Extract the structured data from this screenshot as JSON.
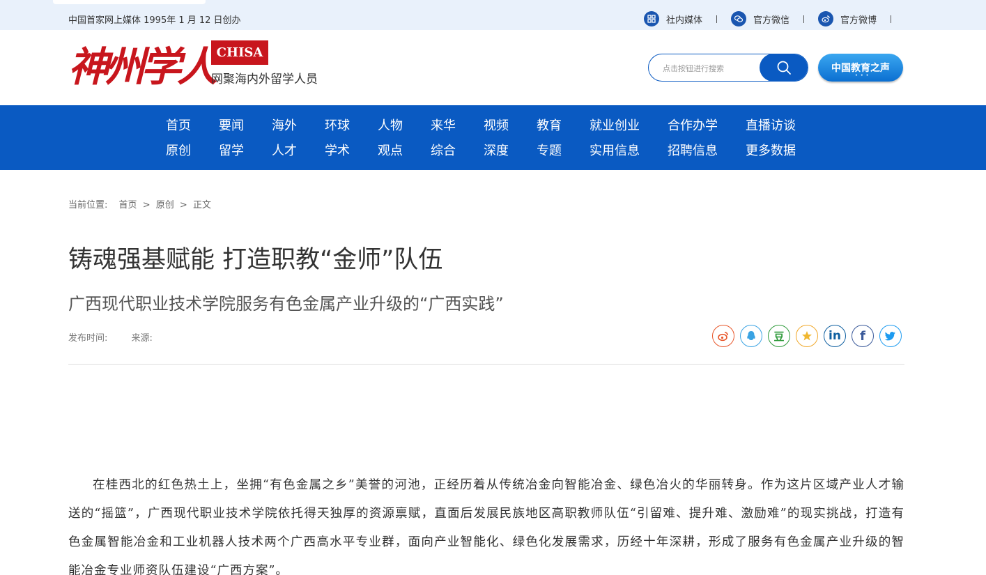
{
  "topbar": {
    "slogan": "中国首家网上媒体 1995年 1 月 12 日创办",
    "links": [
      {
        "label": "社内媒体",
        "icon": "grid-icon"
      },
      {
        "label": "官方微信",
        "icon": "wechat-icon"
      },
      {
        "label": "官方微博",
        "icon": "weibo-icon"
      }
    ]
  },
  "header": {
    "logo_text": "神州学人",
    "logo_badge": "CHISA",
    "tagline": "网聚海内外留学人员",
    "search_placeholder": "点击按钮进行搜索",
    "voice_button": "中国教育之声",
    "colors": {
      "brand_red": "#c8161d",
      "brand_blue": "#0a5ac2"
    }
  },
  "nav": {
    "row1": [
      "首页",
      "要闻",
      "海外",
      "环球",
      "人物",
      "来华",
      "视频",
      "教育",
      "就业创业",
      "合作办学",
      "直播访谈"
    ],
    "row2": [
      "原创",
      "留学",
      "人才",
      "学术",
      "观点",
      "综合",
      "深度",
      "专题",
      "实用信息",
      "招聘信息",
      "更多数据"
    ]
  },
  "breadcrumb": {
    "prefix": "当前位置:",
    "items": [
      "首页",
      "原创",
      "正文"
    ],
    "sep": ">"
  },
  "article": {
    "title": "铸魂强基赋能 打造职教“金师”队伍",
    "subtitle": "广西现代职业技术学院服务有色金属产业升级的“广西实践”",
    "publish_label": "发布时间:",
    "source_label": "来源:",
    "share_icons": [
      "weibo-share-icon",
      "qq-share-icon",
      "douban-share-icon",
      "qzone-share-icon",
      "linkedin-share-icon",
      "facebook-share-icon",
      "twitter-share-icon"
    ],
    "douban_glyph": "豆",
    "linkedin_glyph": "in",
    "facebook_glyph": "f",
    "paragraph": "在桂西北的红色热土上，坐拥“有色金属之乡”美誉的河池，正经历着从传统冶金向智能冶金、绿色冶火的华丽转身。作为这片区域产业人才输送的“摇篮”，广西现代职业技术学院依托得天独厚的资源禀赋，直面后发展民族地区高职教师队伍“引留难、提升难、激励难”的现实挑战，打造有色金属智能冶金和工业机器人技术两个广西高水平专业群，面向产业智能化、绿色化发展需求，历经十年深耕，形成了服务有色金属产业升级的智能冶金专业师资队伍建设“广西方案”。"
  }
}
